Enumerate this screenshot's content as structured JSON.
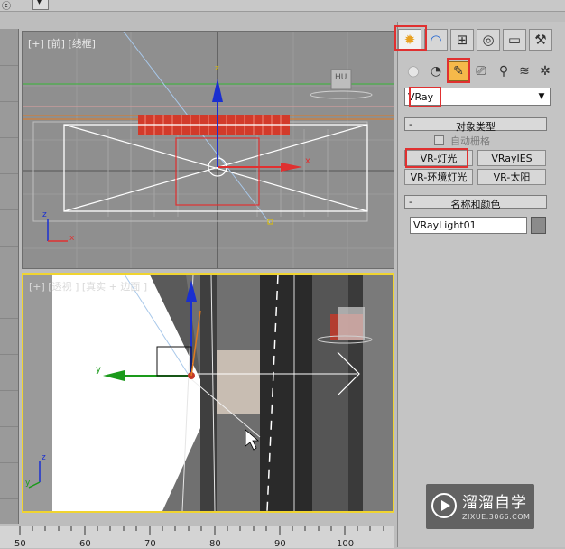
{
  "top_strip": {
    "left_glyph": "ⓒ",
    "menu_glyph": "▾"
  },
  "viewports": {
    "front": {
      "label": "[+] [前] [线框]",
      "axis_z": "z",
      "axis_x": "x",
      "gizmo_x": "x"
    },
    "perspective": {
      "label": "[+] [透视 ] [真实 + 边面 ]",
      "gizmo_y": "y",
      "axis_z": "z",
      "axis_y": "y"
    }
  },
  "ruler": {
    "ticks": [
      "50",
      "60",
      "70",
      "80",
      "90",
      "100"
    ]
  },
  "command_panel": {
    "tabs": [
      {
        "name": "create",
        "icon": "star-icon",
        "glyph": "✹",
        "active": true
      },
      {
        "name": "modify",
        "icon": "modify-arc-icon",
        "glyph": "◠",
        "active": false
      },
      {
        "name": "hierarchy",
        "icon": "hierarchy-icon",
        "glyph": "⊞",
        "active": false
      },
      {
        "name": "motion",
        "icon": "motion-icon",
        "glyph": "◎",
        "active": false
      },
      {
        "name": "display",
        "icon": "monitor-icon",
        "glyph": "▭",
        "active": false
      },
      {
        "name": "utilities",
        "icon": "hammer-icon",
        "glyph": "⚒",
        "active": false
      }
    ],
    "subtabs": [
      {
        "name": "geometry",
        "icon": "sphere-icon",
        "glyph": "●",
        "active": false
      },
      {
        "name": "shapes",
        "icon": "shapes-icon",
        "glyph": "◔",
        "active": false
      },
      {
        "name": "lights",
        "icon": "light-bulb-icon",
        "glyph": "✎",
        "active": true
      },
      {
        "name": "cameras",
        "icon": "camera-icon",
        "glyph": "⎚",
        "active": false
      },
      {
        "name": "helpers",
        "icon": "helper-icon",
        "glyph": "⚲",
        "active": false
      },
      {
        "name": "spacewarps",
        "icon": "wave-icon",
        "glyph": "≋",
        "active": false
      },
      {
        "name": "systems",
        "icon": "gear-icon",
        "glyph": "✲",
        "active": false
      }
    ],
    "category_dropdown": {
      "value": "VRay"
    },
    "object_type": {
      "header": "对象类型",
      "auto_grid_label": "自动栅格",
      "buttons": [
        "VR-灯光",
        "VRayIES",
        "VR-环境灯光",
        "VR-太阳"
      ]
    },
    "name_color": {
      "header": "名称和颜色",
      "name_value": "VRayLight01",
      "swatch_color": "#8b8b8b"
    }
  },
  "watermark": {
    "name": "溜溜自学",
    "url": "ZIXUE.3066.COM"
  },
  "colors": {
    "highlight_red": "#e03030",
    "active_viewport": "#f0d430",
    "gizmo_red": "#e03030",
    "gizmo_blue": "#1a2fd0",
    "gizmo_green": "#1a9a1a"
  }
}
